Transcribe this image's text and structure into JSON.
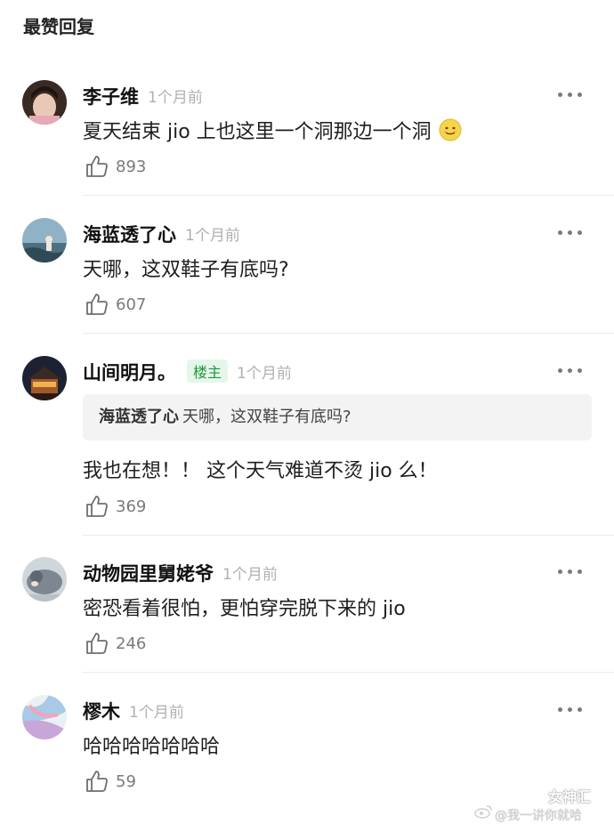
{
  "section_title": "最赞回复",
  "comments": [
    {
      "name": "李子维",
      "time": "1个月前",
      "text": "夏天结束 jio 上也这里一个洞那边一个洞",
      "emoji": "smiley-face-emoji",
      "likes": "893"
    },
    {
      "name": "海蓝透了心",
      "time": "1个月前",
      "text": "天哪，这双鞋子有底吗?",
      "likes": "607"
    },
    {
      "name": "山间明月。",
      "badge": "楼主",
      "time": "1个月前",
      "quote": {
        "name": "海蓝透了心",
        "text": "天哪，这双鞋子有底吗?"
      },
      "text": "我也在想！！ 这个天气难道不烫 jio 么！",
      "likes": "369"
    },
    {
      "name": "动物园里舅姥爷",
      "time": "1个月前",
      "text": "密恐看着很怕，更怕穿完脱下来的 jio",
      "likes": "246"
    },
    {
      "name": "樛木",
      "time": "1个月前",
      "text": "哈哈哈哈哈哈哈",
      "likes": "59"
    }
  ],
  "watermark": {
    "brand": "女神汇",
    "handle": "@我一讲你就哈"
  },
  "icons": {
    "like": "thumbs-up-icon",
    "more": "more-dots-icon"
  }
}
